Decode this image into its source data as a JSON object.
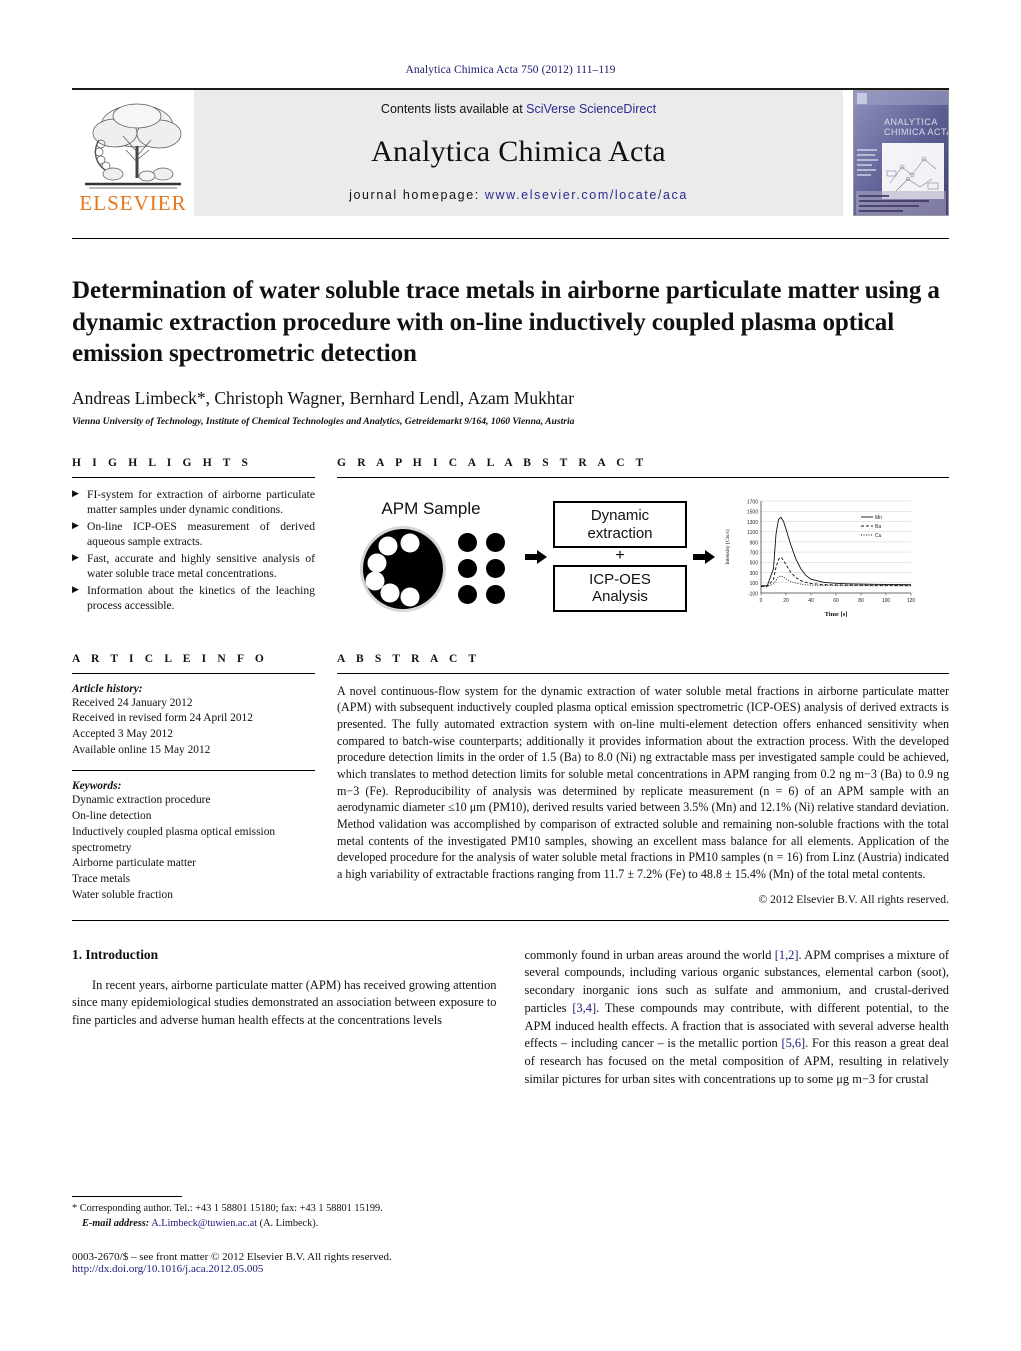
{
  "running_head": "Analytica Chimica Acta 750 (2012) 111–119",
  "masthead": {
    "publisher_wordmark": "ELSEVIER",
    "contents_prefix": "Contents lists available at ",
    "contents_link": "SciVerse ScienceDirect",
    "journal_title": "Analytica Chimica Acta",
    "homepage_prefix": "journal homepage: ",
    "homepage_url": "www.elsevier.com/locate/aca",
    "cover_title_line1": "ANALYTICA",
    "cover_title_line2": "CHIMICA ACTA",
    "accent_orange": "#E8761A",
    "link_blue": "#2b2b8f"
  },
  "article": {
    "title": "Determination of water soluble trace metals in airborne particulate matter using a dynamic extraction procedure with on-line inductively coupled plasma optical emission spectrometric detection",
    "authors": "Andreas Limbeck*, Christoph Wagner, Bernhard Lendl, Azam Mukhtar",
    "affiliation": "Vienna University of Technology, Institute of Chemical Technologies and Analytics, Getreidemarkt 9/164, 1060 Vienna, Austria"
  },
  "highlights": {
    "heading": "H I G H L I G H T S",
    "items": [
      "FI-system for extraction of airborne particulate matter samples under dynamic conditions.",
      "On-line ICP-OES measurement of derived aqueous sample extracts.",
      "Fast, accurate and highly sensitive analysis of water soluble trace metal concentrations.",
      "Information about the kinetics of the leaching process accessible."
    ]
  },
  "graphical_abstract": {
    "heading": "G R A P H I C A L   A B S T R A C T",
    "sample_label": "APM Sample",
    "box1_line1": "Dynamic",
    "box1_line2": "extraction",
    "plus": "+",
    "box2_line1": "ICP-OES",
    "box2_line2": "Analysis"
  },
  "chart_data": {
    "type": "line",
    "title": "",
    "xlabel": "Time [s]",
    "ylabel": "Intensity [Cts/s]",
    "xlim": [
      0,
      120
    ],
    "ylim": [
      -100,
      1700
    ],
    "xticks": [
      0,
      20,
      40,
      60,
      80,
      100,
      120
    ],
    "yticks": [
      -100,
      100,
      300,
      500,
      700,
      900,
      1100,
      1300,
      1500,
      1700
    ],
    "grid": true,
    "legend_position": "top-right",
    "x": [
      0,
      5,
      10,
      12,
      14,
      16,
      18,
      20,
      24,
      28,
      32,
      36,
      40,
      50,
      60,
      70,
      80,
      90,
      100,
      110,
      120
    ],
    "series": [
      {
        "name": "Mn",
        "style": "solid",
        "values": [
          40,
          45,
          380,
          1050,
          1340,
          1380,
          1300,
          1150,
          830,
          560,
          370,
          240,
          170,
          110,
          90,
          80,
          75,
          70,
          68,
          65,
          62
        ]
      },
      {
        "name": "Ba",
        "style": "dashed",
        "values": [
          30,
          33,
          160,
          400,
          560,
          600,
          540,
          450,
          300,
          200,
          140,
          105,
          85,
          65,
          58,
          55,
          52,
          50,
          50,
          48,
          46
        ]
      },
      {
        "name": "Cu",
        "style": "dotted",
        "values": [
          25,
          28,
          80,
          150,
          215,
          235,
          210,
          175,
          125,
          92,
          72,
          60,
          54,
          46,
          44,
          42,
          42,
          40,
          40,
          40,
          38
        ]
      }
    ]
  },
  "article_info": {
    "heading": "A R T I C L E   I N F O",
    "history_label": "Article history:",
    "history": [
      "Received 24 January 2012",
      "Received in revised form 24 April 2012",
      "Accepted 3 May 2012",
      "Available online 15 May 2012"
    ],
    "keywords_label": "Keywords:",
    "keywords": [
      "Dynamic extraction procedure",
      "On-line detection",
      "Inductively coupled plasma optical emission spectrometry",
      "Airborne particulate matter",
      "Trace metals",
      "Water soluble fraction"
    ]
  },
  "abstract": {
    "heading": "A B S T R A C T",
    "text": "A novel continuous-flow system for the dynamic extraction of water soluble metal fractions in airborne particulate matter (APM) with subsequent inductively coupled plasma optical emission spectrometric (ICP-OES) analysis of derived extracts is presented. The fully automated extraction system with on-line multi-element detection offers enhanced sensitivity when compared to batch-wise counterparts; additionally it provides information about the extraction process. With the developed procedure detection limits in the order of 1.5 (Ba) to 8.0 (Ni) ng extractable mass per investigated sample could be achieved, which translates to method detection limits for soluble metal concentrations in APM ranging from 0.2 ng m−3 (Ba) to 0.9 ng m−3 (Fe). Reproducibility of analysis was determined by replicate measurement (n = 6) of an APM sample with an aerodynamic diameter ≤10 μm (PM10), derived results varied between 3.5% (Mn) and 12.1% (Ni) relative standard deviation. Method validation was accomplished by comparison of extracted soluble and remaining non-soluble fractions with the total metal contents of the investigated PM10 samples, showing an excellent mass balance for all elements. Application of the developed procedure for the analysis of water soluble metal fractions in PM10 samples (n = 16) from Linz (Austria) indicated a high variability of extractable fractions ranging from 11.7 ± 7.2% (Fe) to 48.8 ± 15.4% (Mn) of the total metal contents.",
    "copyright": "© 2012 Elsevier B.V. All rights reserved."
  },
  "introduction": {
    "heading": "1.  Introduction",
    "col1": "In recent years, airborne particulate matter (APM) has received growing attention since many epidemiological studies demonstrated an association between exposure to fine particles and adverse human health effects at the concentrations levels",
    "col2_part1": "commonly found in urban areas around the world ",
    "col2_ref1": "[1,2]",
    "col2_part2": ". APM comprises a mixture of several compounds, including various organic substances, elemental carbon (soot), secondary inorganic ions such as sulfate and ammonium, and crustal-derived particles ",
    "col2_ref2": "[3,4]",
    "col2_part3": ". These compounds may contribute, with different potential, to the APM induced health effects. A fraction that is associated with several adverse health effects – including cancer – is the metallic portion ",
    "col2_ref3": "[5,6]",
    "col2_part4": ". For this reason a great deal of research has focused on the metal composition of APM, resulting in relatively similar pictures for urban sites with concentrations up to some μg m−3 for crustal"
  },
  "footer": {
    "corresponding": "* Corresponding author. Tel.: +43 1 58801 15180; fax: +43 1 58801 15199.",
    "email_label": "E-mail address:",
    "email": "A.Limbeck@tuwien.ac.at",
    "email_suffix": "(A. Limbeck).",
    "issn": "0003-2670/$ – see front matter © 2012 Elsevier B.V. All rights reserved.",
    "doi": "http://dx.doi.org/10.1016/j.aca.2012.05.005"
  }
}
